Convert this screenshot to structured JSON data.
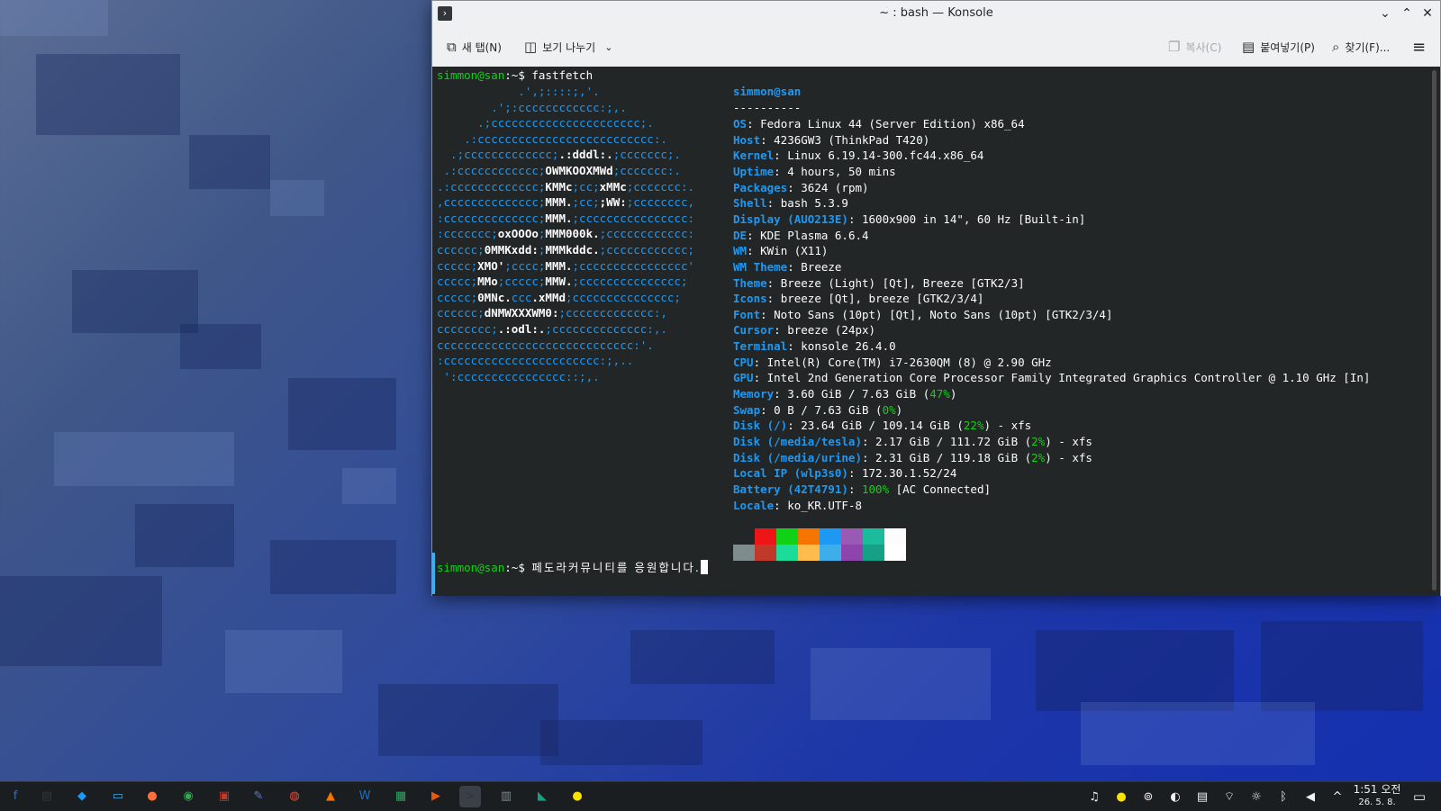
{
  "window": {
    "title": "~ : bash — Konsole",
    "min_icon": "chevron-down-icon",
    "max_icon": "chevron-up-icon",
    "close_icon": "close-icon"
  },
  "toolbar": {
    "new_tab": "새 탭(N)",
    "split_view": "보기 나누기",
    "copy": "복사(C)",
    "paste": "붙여넣기(P)",
    "find": "찾기(F)...",
    "menu_icon": "hamburger-icon"
  },
  "terminal": {
    "prompt_user": "simmon@san",
    "prompt_sep": ":~$ ",
    "command": "fastfetch",
    "input_text": "페도라커뮤니티를 응원합니다.",
    "header_title": "simmon@san",
    "separator": "----------",
    "info": [
      {
        "key": "OS",
        "value": ": Fedora Linux 44 (Server Edition) x86_64"
      },
      {
        "key": "Host",
        "value": ": 4236GW3 (ThinkPad T420)"
      },
      {
        "key": "Kernel",
        "value": ": Linux 6.19.14-300.fc44.x86_64"
      },
      {
        "key": "Uptime",
        "value": ": 4 hours, 50 mins"
      },
      {
        "key": "Packages",
        "value": ": 3624 (rpm)"
      },
      {
        "key": "Shell",
        "value": ": bash 5.3.9"
      },
      {
        "key": "Display (AUO213E)",
        "value": ": 1600x900 in 14\", 60 Hz [Built-in]"
      },
      {
        "key": "DE",
        "value": ": KDE Plasma 6.6.4"
      },
      {
        "key": "WM",
        "value": ": KWin (X11)"
      },
      {
        "key": "WM Theme",
        "value": ": Breeze"
      },
      {
        "key": "Theme",
        "value": ": Breeze (Light) [Qt], Breeze [GTK2/3]"
      },
      {
        "key": "Icons",
        "value": ": breeze [Qt], breeze [GTK2/3/4]"
      },
      {
        "key": "Font",
        "value": ": Noto Sans (10pt) [Qt], Noto Sans (10pt) [GTK2/3/4]"
      },
      {
        "key": "Cursor",
        "value": ": breeze (24px)"
      },
      {
        "key": "Terminal",
        "value": ": konsole 26.4.0"
      },
      {
        "key": "CPU",
        "value": ": Intel(R) Core(TM) i7-2630QM (8) @ 2.90 GHz"
      },
      {
        "key": "GPU",
        "value": ": Intel 2nd Generation Core Processor Family Integrated Graphics Controller @ 1.10 GHz [In]"
      },
      {
        "key": "Memory",
        "value": ": 3.60 GiB / 7.63 GiB (",
        "pct": "47%",
        "tail": ")"
      },
      {
        "key": "Swap",
        "value": ": 0 B / 7.63 GiB (",
        "pct": "0%",
        "tail": ")"
      },
      {
        "key": "Disk (/)",
        "value": ": 23.64 GiB / 109.14 GiB (",
        "pct": "22%",
        "tail": ") - xfs"
      },
      {
        "key": "Disk (/media/tesla)",
        "value": ": 2.17 GiB / 111.72 GiB (",
        "pct": "2%",
        "tail": ") - xfs"
      },
      {
        "key": "Disk (/media/urine)",
        "value": ": 2.31 GiB / 119.18 GiB (",
        "pct": "2%",
        "tail": ") - xfs"
      },
      {
        "key": "Local IP (wlp3s0)",
        "value": ": 172.30.1.52/24"
      },
      {
        "key": "Battery (42T4791)",
        "value": ": ",
        "pct": "100%",
        "tail": " [AC Connected]"
      },
      {
        "key": "Locale",
        "value": ": ko_KR.UTF-8"
      }
    ],
    "logo": [
      [
        [
          "c",
          "            .',;::::;,'."
        ]
      ],
      [
        [
          "c",
          "        .';:cccccccccccc:;,."
        ]
      ],
      [
        [
          "c",
          "      .;cccccccccccccccccccccc;."
        ]
      ],
      [
        [
          "c",
          "    .:cccccccccccccccccccccccccc:."
        ]
      ],
      [
        [
          "c",
          "  .;ccccccccccccc;"
        ],
        [
          "w",
          ".:dddl:."
        ],
        [
          "c",
          ";ccccccc;."
        ]
      ],
      [
        [
          "c",
          " .:cccccccccccc;"
        ],
        [
          "w",
          "OWMKOOXMWd"
        ],
        [
          "c",
          ";ccccccc:."
        ]
      ],
      [
        [
          "c",
          ".:ccccccccccccc;"
        ],
        [
          "w",
          "KMMc"
        ],
        [
          "c",
          ";cc;"
        ],
        [
          "w",
          "xMMc"
        ],
        [
          "c",
          ";ccccccc:."
        ]
      ],
      [
        [
          "c",
          ",cccccccccccccc;"
        ],
        [
          "w",
          "MMM."
        ],
        [
          "c",
          ";cc;"
        ],
        [
          "w",
          ";WW:"
        ],
        [
          "c",
          ";cccccccc,"
        ]
      ],
      [
        [
          "c",
          ":cccccccccccccc;"
        ],
        [
          "w",
          "MMM."
        ],
        [
          "c",
          ";cccccccccccccccc:"
        ]
      ],
      [
        [
          "c",
          ":ccccccc;"
        ],
        [
          "w",
          "oxOOOo"
        ],
        [
          "c",
          ";"
        ],
        [
          "w",
          "MMM000k."
        ],
        [
          "c",
          ";cccccccccccc:"
        ]
      ],
      [
        [
          "c",
          "cccccc;"
        ],
        [
          "w",
          "0MMKxdd:"
        ],
        [
          "c",
          ";"
        ],
        [
          "w",
          "MMMkddc."
        ],
        [
          "c",
          ";cccccccccccc;"
        ]
      ],
      [
        [
          "c",
          "ccccc;"
        ],
        [
          "w",
          "XMO'"
        ],
        [
          "c",
          ";cccc;"
        ],
        [
          "w",
          "MMM."
        ],
        [
          "c",
          ";cccccccccccccccc'"
        ]
      ],
      [
        [
          "c",
          "ccccc;"
        ],
        [
          "w",
          "MMo"
        ],
        [
          "c",
          ";ccccc;"
        ],
        [
          "w",
          "MMW."
        ],
        [
          "c",
          ";ccccccccccccccc;"
        ]
      ],
      [
        [
          "c",
          "ccccc;"
        ],
        [
          "w",
          "0MNc."
        ],
        [
          "c",
          "ccc"
        ],
        [
          "w",
          ".xMMd"
        ],
        [
          "c",
          ";ccccccccccccccc;"
        ]
      ],
      [
        [
          "c",
          "cccccc;"
        ],
        [
          "w",
          "dNMWXXXWM0:"
        ],
        [
          "c",
          ";ccccccccccccc:,"
        ]
      ],
      [
        [
          "c",
          "cccccccc;"
        ],
        [
          "w",
          ".:odl:."
        ],
        [
          "c",
          ";cccccccccccccc:,."
        ]
      ],
      [
        [
          "c",
          "ccccccccccccccccccccccccccccc:'."
        ]
      ],
      [
        [
          "c",
          ":ccccccccccccccccccccccc:;,.."
        ]
      ],
      [
        [
          "c",
          " ':cccccccccccccccc::;,."
        ]
      ]
    ],
    "palette_top": [
      "#232627",
      "#ed1515",
      "#11d116",
      "#f67400",
      "#1d99f3",
      "#9b59b6",
      "#1abc9c",
      "#fcfcfc"
    ],
    "palette_bottom": [
      "#7f8c8d",
      "#c0392b",
      "#1cdc9a",
      "#fdbc4b",
      "#3daee9",
      "#8e44ad",
      "#16a085",
      "#ffffff"
    ]
  },
  "taskbar": {
    "apps": [
      {
        "name": "app-launcher-icon",
        "glyph": "f",
        "color": "#3c6eb4"
      },
      {
        "name": "system-monitor-icon",
        "glyph": "▤",
        "color": "#31363b"
      },
      {
        "name": "discover-store-icon",
        "glyph": "◆",
        "color": "#1d99f3"
      },
      {
        "name": "file-manager-icon",
        "glyph": "▭",
        "color": "#3daee9"
      },
      {
        "name": "firefox-icon",
        "glyph": "●",
        "color": "#ff7139"
      },
      {
        "name": "chrome-icon",
        "glyph": "◉",
        "color": "#34a853"
      },
      {
        "name": "archive-icon",
        "glyph": "▣",
        "color": "#c0392b"
      },
      {
        "name": "text-editor-icon",
        "glyph": "✎",
        "color": "#5d7bd5"
      },
      {
        "name": "disk-utility-icon",
        "glyph": "◍",
        "color": "#e74c3c"
      },
      {
        "name": "vlc-icon",
        "glyph": "▲",
        "color": "#f67400"
      },
      {
        "name": "writer-icon",
        "glyph": "W",
        "color": "#1d6fbf"
      },
      {
        "name": "calc-icon",
        "glyph": "▦",
        "color": "#27ae60"
      },
      {
        "name": "impress-icon",
        "glyph": "▶",
        "color": "#e8590c"
      },
      {
        "name": "konsole-icon",
        "glyph": ">",
        "color": "#31363b"
      },
      {
        "name": "remote-desktop-icon",
        "glyph": "▥",
        "color": "#7f8c8d"
      },
      {
        "name": "vscode-icon",
        "glyph": "◣",
        "color": "#16a085"
      },
      {
        "name": "kakaotalk-icon",
        "glyph": "●",
        "color": "#fae100"
      }
    ],
    "tray": [
      {
        "name": "notifications-icon",
        "glyph": "♫"
      },
      {
        "name": "kakaotalk-tray-icon",
        "glyph": "●"
      },
      {
        "name": "updates-icon",
        "glyph": "⊚"
      },
      {
        "name": "color-picker-icon",
        "glyph": "◐"
      },
      {
        "name": "clipboard-icon",
        "glyph": "▤"
      },
      {
        "name": "wifi-icon",
        "glyph": "⌔"
      },
      {
        "name": "brightness-icon",
        "glyph": "☼"
      },
      {
        "name": "bluetooth-icon",
        "glyph": "ᛒ"
      },
      {
        "name": "volume-icon",
        "glyph": "◀"
      },
      {
        "name": "tray-expand-icon",
        "glyph": "^"
      }
    ],
    "clock_time": "1:51 오전",
    "clock_date": "26. 5. 8."
  }
}
